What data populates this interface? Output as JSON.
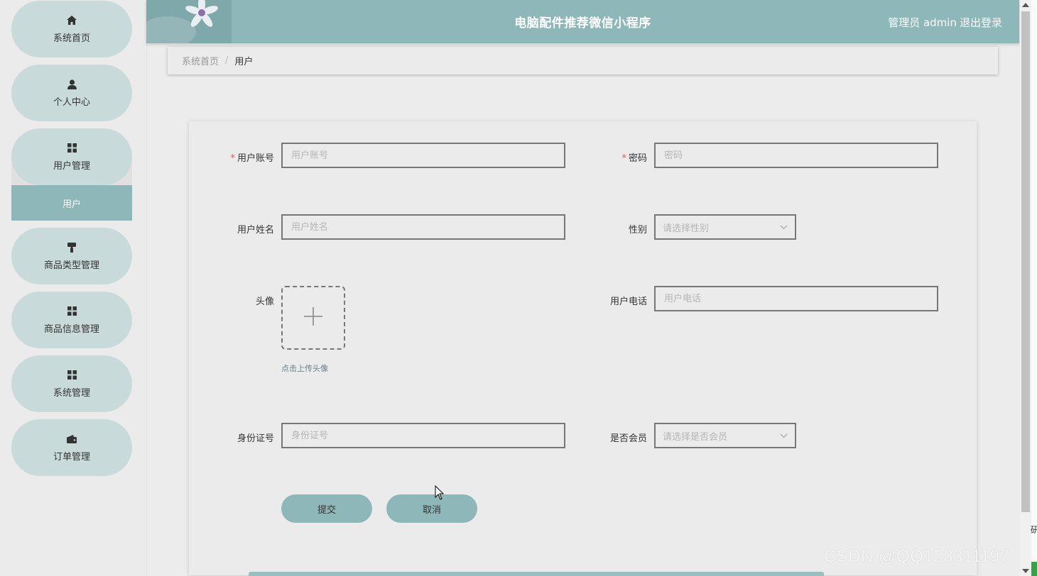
{
  "sidebar": {
    "items": [
      {
        "label": "系统首页",
        "icon": "home-icon"
      },
      {
        "label": "个人中心",
        "icon": "user-icon"
      },
      {
        "label": "用户管理",
        "icon": "grid-icon"
      },
      {
        "label": "商品类型管理",
        "icon": "paint-roller-icon"
      },
      {
        "label": "商品信息管理",
        "icon": "grid-icon"
      },
      {
        "label": "系统管理",
        "icon": "grid-icon"
      },
      {
        "label": "订单管理",
        "icon": "wallet-icon"
      }
    ],
    "active_sub": "用户"
  },
  "header": {
    "title": "电脑配件推荐微信小程序",
    "user": "管理员 admin",
    "logout": "退出登录"
  },
  "breadcrumb": {
    "home": "系统首页",
    "separator": "/",
    "current": "用户"
  },
  "form": {
    "account": {
      "label": "用户账号",
      "placeholder": "用户账号",
      "value": "",
      "required": true
    },
    "password": {
      "label": "密码",
      "placeholder": "密码",
      "value": "",
      "required": true
    },
    "name": {
      "label": "用户姓名",
      "placeholder": "用户姓名",
      "value": ""
    },
    "gender": {
      "label": "性别",
      "placeholder": "请选择性别"
    },
    "avatar": {
      "label": "头像",
      "hint": "点击上传头像"
    },
    "phone": {
      "label": "用户电话",
      "placeholder": "用户电话",
      "value": ""
    },
    "idcard": {
      "label": "身份证号",
      "placeholder": "身份证号",
      "value": ""
    },
    "member": {
      "label": "是否会员",
      "placeholder": "请选择是否会员"
    },
    "submit": "提交",
    "cancel": "取消",
    "required_mark": "*"
  },
  "edge_text": "研",
  "watermark": "CSDN @QQ123311197",
  "colors": {
    "accent": "#8eb7b9",
    "nav_pill": "#c9dada",
    "required": "#e05555"
  }
}
